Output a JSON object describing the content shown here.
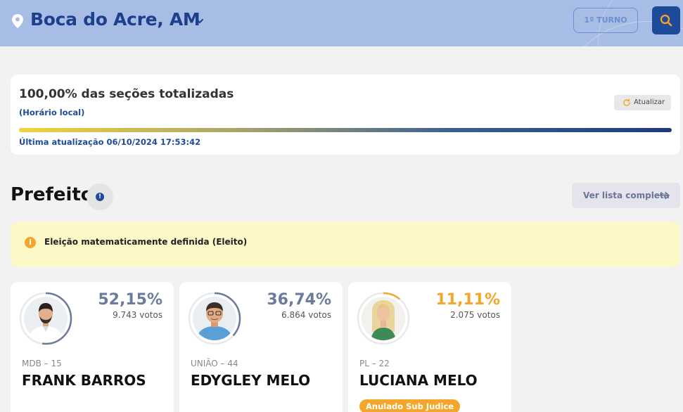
{
  "header": {
    "city": "Boca do Acre, AM",
    "turno_label": "1º TURNO"
  },
  "status": {
    "title": "100,00% das seções totalizadas",
    "horario": "(Horário local)",
    "refresh_label": "Atualizar",
    "progress_fraction": 1.0,
    "last_update": "Última atualização 06/10/2024 17:53:42"
  },
  "section": {
    "title": "Prefeito",
    "ver_lista_label": "Ver lista completa"
  },
  "banner": {
    "text": "Eleição matematicamente definida (Eleito)"
  },
  "candidates": [
    {
      "party": "MDB – 15",
      "name": "FRANK BARROS",
      "percent": "52,15%",
      "votes": "9.743 votos",
      "share": 0.5215,
      "color": "#6c7b99",
      "badge": ""
    },
    {
      "party": "UNIÃO – 44",
      "name": "EDYGLEY MELO",
      "percent": "36,74%",
      "votes": "6.864 votos",
      "share": 0.3674,
      "color": "#6c7b99",
      "badge": ""
    },
    {
      "party": "PL – 22",
      "name": "LUCIANA MELO",
      "percent": "11,11%",
      "votes": "2.075 votos",
      "share": 0.1111,
      "color": "#f4a62a",
      "badge": "Anulado Sub Judice"
    }
  ],
  "icons": {
    "location": "location-pin-icon",
    "dropdown": "chevron-down-icon",
    "search": "search-icon",
    "refresh": "refresh-icon",
    "info": "info-icon",
    "arrow": "arrow-right-icon"
  }
}
